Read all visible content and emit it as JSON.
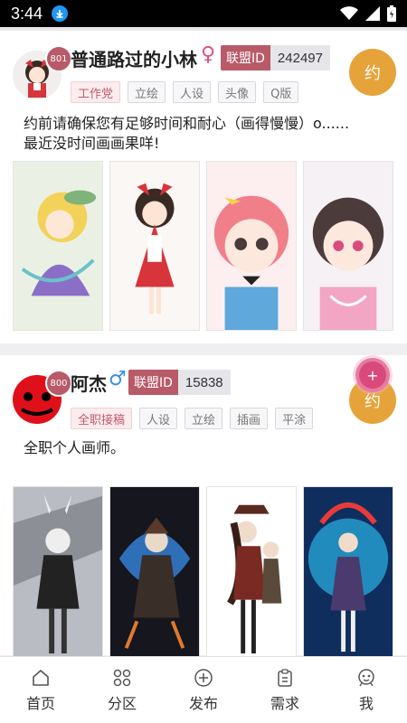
{
  "status_bar": {
    "time": "3:44"
  },
  "cards": [
    {
      "level": "801",
      "username": "普通路过的小林",
      "gender": "♀",
      "alliance_label": "联盟ID",
      "alliance_id": "242497",
      "action_label": "约",
      "tags": [
        "工作党",
        "立绘",
        "人设",
        "头像",
        "Q版"
      ],
      "description": [
        "约前请确保您有足够时间和耐心（画得慢慢）o......",
        "最近没时间画画果咩!"
      ]
    },
    {
      "level": "800",
      "username": "阿杰",
      "gender": "♂",
      "alliance_label": "联盟ID",
      "alliance_id": "15838",
      "action_label": "约",
      "tags": [
        "全职接稿",
        "人设",
        "立绘",
        "插画",
        "平涂"
      ],
      "description": [
        "全职个人画师。"
      ]
    }
  ],
  "fab": {
    "label": "+"
  },
  "nav": [
    {
      "label": "首页",
      "icon": "home-icon"
    },
    {
      "label": "分区",
      "icon": "grid-icon"
    },
    {
      "label": "发布",
      "icon": "plus-circle-icon"
    },
    {
      "label": "需求",
      "icon": "clipboard-icon"
    },
    {
      "label": "我",
      "icon": "profile-icon"
    }
  ],
  "colors": {
    "accent": "#b85a68",
    "action": "#e6a33a",
    "fab": "#d9497c"
  }
}
